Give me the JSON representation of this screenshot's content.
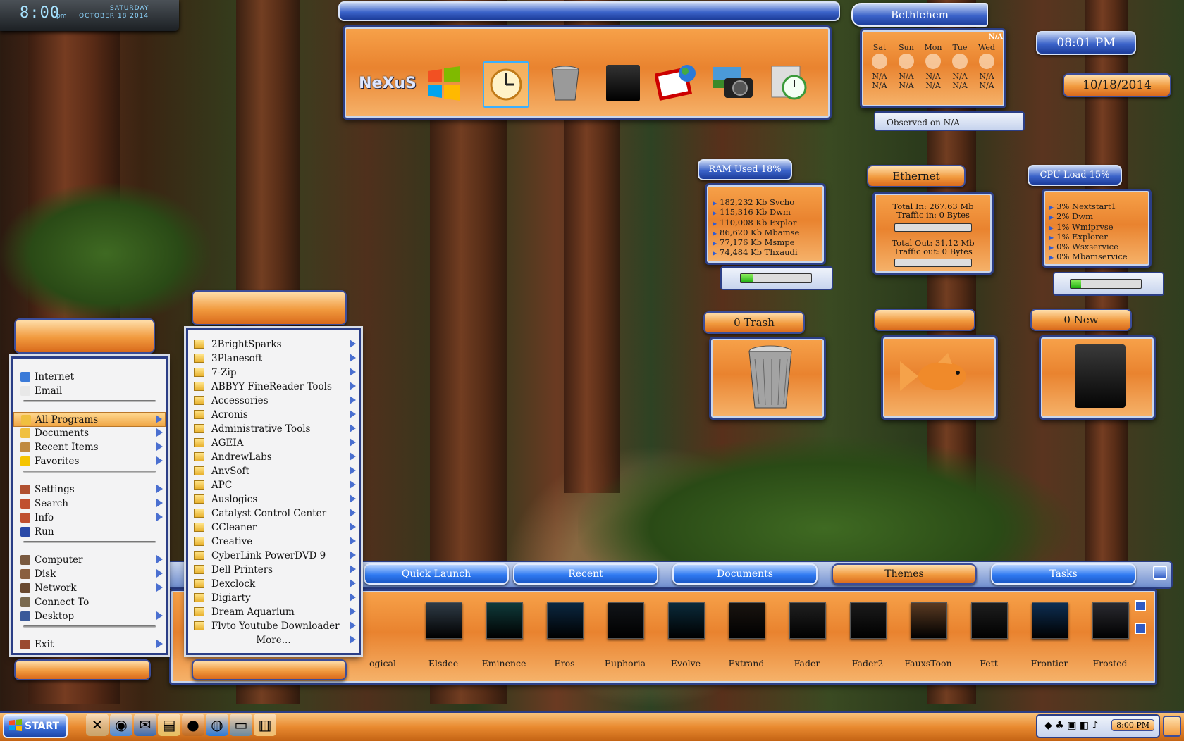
{
  "clock": {
    "time": "8:00",
    "ampm": "pm",
    "day": "SATURDAY",
    "date": "OCTOBER 18 2014"
  },
  "dock": {
    "icons": [
      "nexus-logo-icon",
      "windows-logo-icon",
      "clock-icon",
      "trash-icon",
      "black-box-icon",
      "paint-icon",
      "camera-icon",
      "clock-utility-icon"
    ]
  },
  "weather": {
    "city": "Bethlehem",
    "top_right": "N/A",
    "days": [
      "Sat",
      "Sun",
      "Mon",
      "Tue",
      "Wed"
    ],
    "hi": [
      "N/A",
      "N/A",
      "N/A",
      "N/A",
      "N/A"
    ],
    "lo": [
      "N/A",
      "N/A",
      "N/A",
      "N/A",
      "N/A"
    ],
    "observed": "Observed on N/A"
  },
  "datetime": {
    "time": "08:01 PM",
    "date": "10/18/2014"
  },
  "ram": {
    "title": "RAM Used 18%",
    "level": 0.18,
    "items": [
      "182,232 Kb Svcho",
      "115,316 Kb Dwm",
      "110,008 Kb Explor",
      "86,620 Kb Mbamse",
      "77,176 Kb Msmpe",
      "74,484 Kb Thxaudi"
    ]
  },
  "ethernet": {
    "title": "Ethernet",
    "total_in": "Total In: 267.63 Mb",
    "traffic_in": "Traffic in: 0 Bytes",
    "total_out": "Total Out: 31.12 Mb",
    "traffic_out": "Traffic out: 0 Bytes"
  },
  "cpu": {
    "title": "CPU Load 15%",
    "level": 0.15,
    "items": [
      "3% Nextstart1",
      "2% Dwm",
      "1% Wmiprvse",
      "1% Explorer",
      "0% Wsxservice",
      "0% Mbamservice"
    ]
  },
  "trash": {
    "title": "0 Trash"
  },
  "newmail": {
    "title": "0 New"
  },
  "startmenu": {
    "items": [
      {
        "label": "Internet",
        "icon": "internet-icon",
        "arrow": false
      },
      {
        "label": "Email",
        "icon": "email-icon",
        "arrow": false
      },
      {
        "label": "All Programs",
        "icon": "folder-icon",
        "arrow": true
      },
      {
        "label": "Documents",
        "icon": "documents-icon",
        "arrow": true
      },
      {
        "label": "Recent Items",
        "icon": "recent-icon",
        "arrow": true
      },
      {
        "label": "Favorites",
        "icon": "star-icon",
        "arrow": true
      },
      {
        "label": "Settings",
        "icon": "settings-icon",
        "arrow": true
      },
      {
        "label": "Search",
        "icon": "search-icon",
        "arrow": true
      },
      {
        "label": "Info",
        "icon": "info-icon",
        "arrow": true
      },
      {
        "label": "Run",
        "icon": "run-icon",
        "arrow": false
      },
      {
        "label": "Computer",
        "icon": "computer-icon",
        "arrow": true
      },
      {
        "label": "Disk",
        "icon": "disk-icon",
        "arrow": true
      },
      {
        "label": "Network",
        "icon": "network-icon",
        "arrow": true
      },
      {
        "label": "Connect To",
        "icon": "connect-icon",
        "arrow": false
      },
      {
        "label": "Desktop",
        "icon": "desktop-icon",
        "arrow": true
      },
      {
        "label": "Exit",
        "icon": "exit-icon",
        "arrow": true
      }
    ]
  },
  "programs": {
    "items": [
      "2BrightSparks",
      "3Planesoft",
      "7-Zip",
      "ABBYY FineReader Tools",
      "Accessories",
      "Acronis",
      "Administrative Tools",
      "AGEIA",
      "AndrewLabs",
      "AnvSoft",
      "APC",
      "Auslogics",
      "Catalyst Control Center",
      "CCleaner",
      "Creative",
      "CyberLink PowerDVD 9",
      "Dell Printers",
      "Dexclock",
      "Digiarty",
      "Dream Aquarium",
      "Flvto Youtube Downloader"
    ],
    "more": "More..."
  },
  "tabs": {
    "items": [
      "Quick Launch",
      "Recent",
      "Documents",
      "Themes",
      "Tasks"
    ],
    "active": "Themes"
  },
  "themes": {
    "items": [
      "ogical",
      "Elsdee",
      "Eminence",
      "Eros",
      "Euphoria",
      "Evolve",
      "Extrand",
      "Fader",
      "Fader2",
      "FauxsToon",
      "Fett",
      "Frontier",
      "Frosted"
    ],
    "colors": [
      "#4a4a4a",
      "#2f3b46",
      "#0f3a3a",
      "#0b2740",
      "#111418",
      "#0a2a3a",
      "#1a1410",
      "#202020",
      "#1b1b1b",
      "#5a3a22",
      "#1e1e1e",
      "#0d2e52",
      "#2a2a30"
    ]
  },
  "taskbar": {
    "start": "START",
    "tray_time": "8:00 PM",
    "icons": [
      "tools-icon",
      "globe-icon",
      "thunderbird-icon",
      "folder-icon",
      "media-icon",
      "network-globe-icon",
      "monitor-icon",
      "book-icon"
    ]
  }
}
